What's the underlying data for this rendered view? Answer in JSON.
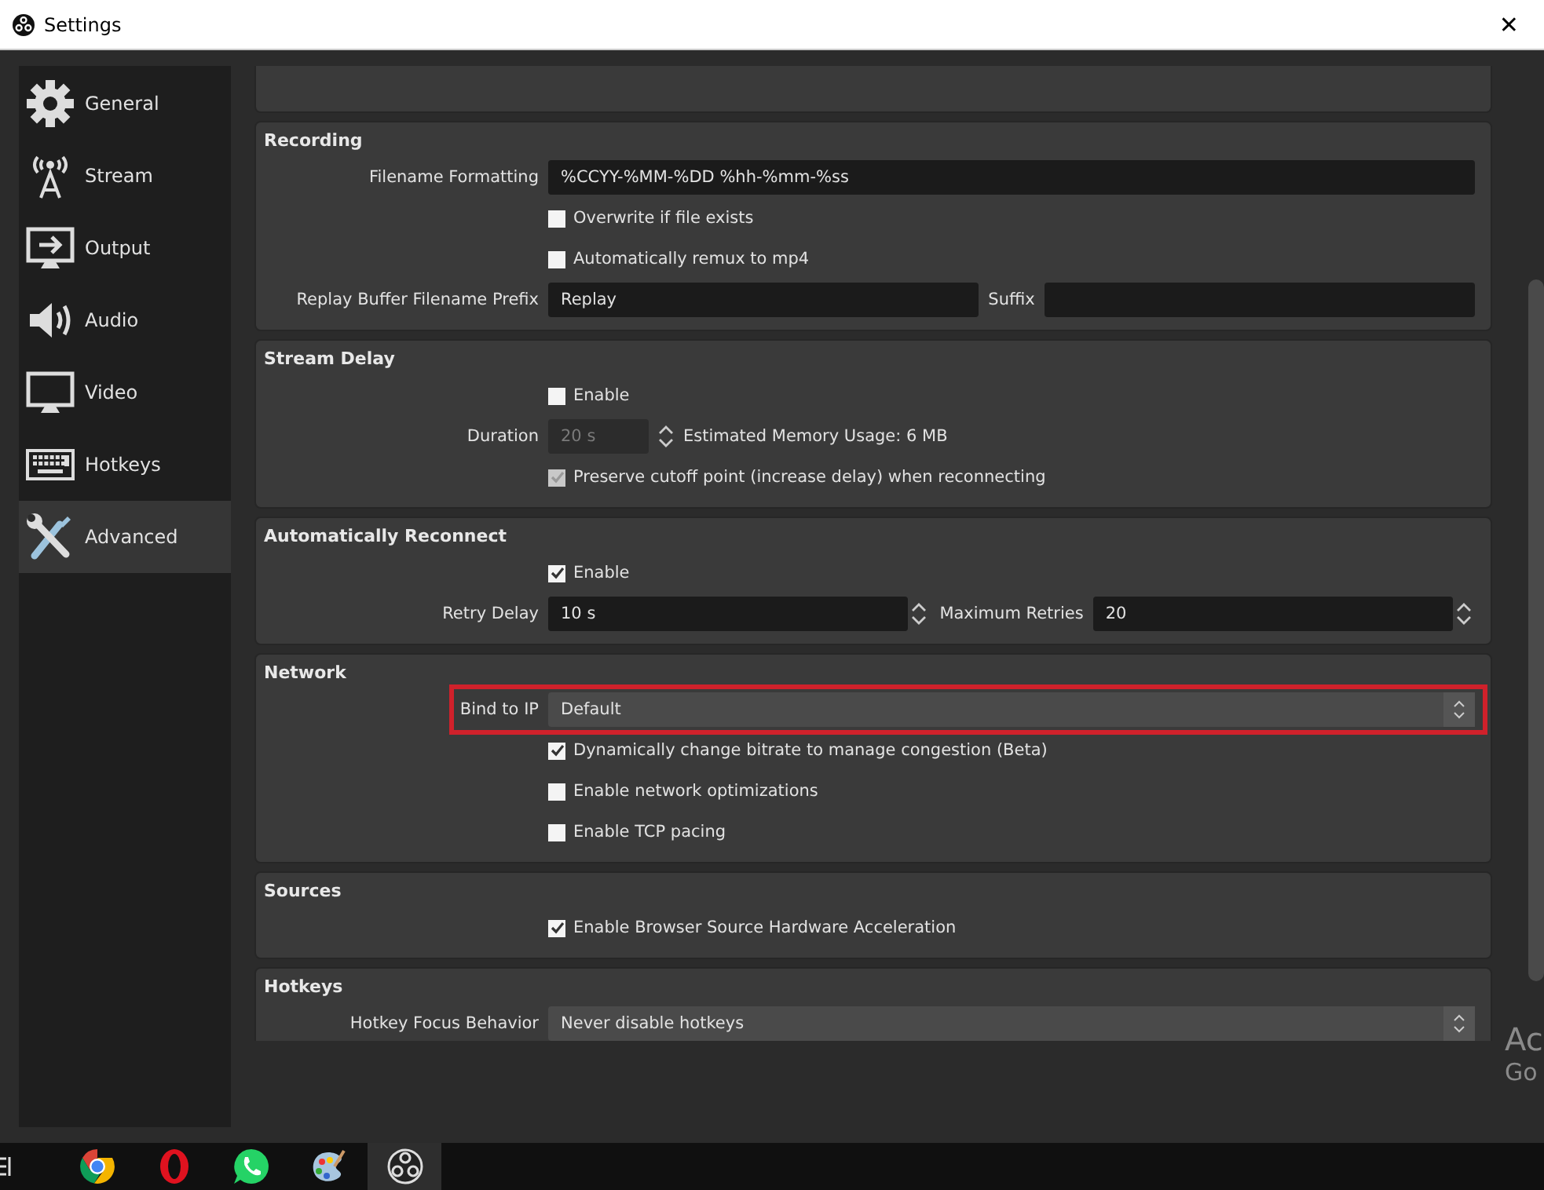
{
  "window": {
    "title": "Settings",
    "close": "✕"
  },
  "sidebar": {
    "items": [
      {
        "label": "General",
        "selected": false
      },
      {
        "label": "Stream",
        "selected": false
      },
      {
        "label": "Output",
        "selected": false
      },
      {
        "label": "Audio",
        "selected": false
      },
      {
        "label": "Video",
        "selected": false
      },
      {
        "label": "Hotkeys",
        "selected": false
      },
      {
        "label": "Advanced",
        "selected": true
      }
    ]
  },
  "sections": [
    {
      "kind": "stub"
    },
    {
      "title": "Recording",
      "rows": [
        {
          "kind": "text",
          "label": "Filename Formatting",
          "value": "%CCYY-%MM-%DD %hh-%mm-%ss"
        },
        {
          "kind": "checkbox",
          "label": "Overwrite if file exists",
          "checked": false,
          "disabled": false
        },
        {
          "kind": "checkbox",
          "label": "Automatically remux to mp4",
          "checked": false,
          "disabled": false
        },
        {
          "kind": "text_pair",
          "label": "Replay Buffer Filename Prefix",
          "value": "Replay",
          "label2": "Suffix"
        }
      ]
    },
    {
      "title": "Stream Delay",
      "rows": [
        {
          "kind": "checkbox",
          "label": "Enable",
          "checked": false,
          "disabled": false
        },
        {
          "kind": "spin",
          "label": "Duration",
          "value": "20 s",
          "disabled": true,
          "note": "Estimated Memory Usage: 6 MB"
        },
        {
          "kind": "checkbox",
          "label": "Preserve cutoff point (increase delay) when reconnecting",
          "checked": true,
          "disabled": true
        }
      ]
    },
    {
      "title": "Automatically Reconnect",
      "rows": [
        {
          "kind": "checkbox",
          "label": "Enable",
          "checked": true,
          "disabled": false
        },
        {
          "kind": "spin_pair",
          "label": "Retry Delay",
          "value": "10 s",
          "label2": "Maximum Retries",
          "value2": "20"
        }
      ]
    },
    {
      "title": "Network",
      "rows": [
        {
          "kind": "combo",
          "label": "Bind to IP",
          "value": "Default",
          "highlighted": true
        },
        {
          "kind": "checkbox",
          "label": "Dynamically change bitrate to manage congestion (Beta)",
          "checked": true,
          "disabled": false
        },
        {
          "kind": "checkbox",
          "label": "Enable network optimizations",
          "checked": false,
          "disabled": false
        },
        {
          "kind": "checkbox",
          "label": "Enable TCP pacing",
          "checked": false,
          "disabled": false
        }
      ]
    },
    {
      "title": "Sources",
      "rows": [
        {
          "kind": "checkbox",
          "label": "Enable Browser Source Hardware Acceleration",
          "checked": true,
          "disabled": false
        }
      ]
    },
    {
      "title": "Hotkeys",
      "rows": [
        {
          "kind": "combo",
          "label": "Hotkey Focus Behavior",
          "value": "Never disable hotkeys"
        }
      ]
    }
  ],
  "os_overlay": {
    "lines": [
      "Ac",
      "Go"
    ]
  },
  "taskbar": {
    "apps": [
      {
        "selected": false
      },
      {
        "selected": false
      },
      {
        "selected": false
      },
      {
        "selected": false
      },
      {
        "selected": true
      }
    ]
  }
}
